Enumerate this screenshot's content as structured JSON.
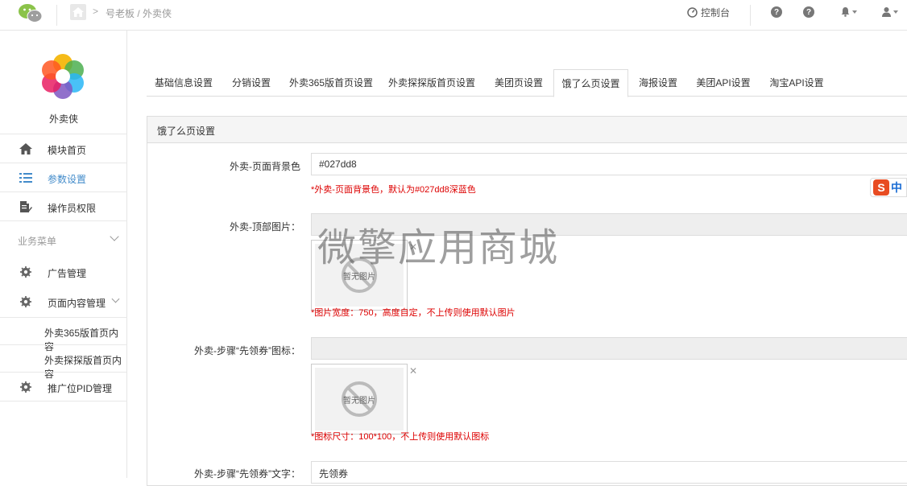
{
  "header": {
    "breadcrumb": "号老板 / 外卖侠",
    "breadcrumb_sep": ">",
    "console_label": "控制台"
  },
  "sidebar": {
    "brand_name": "外卖侠",
    "items": [
      {
        "label": "模块首页",
        "icon": "home-icon"
      },
      {
        "label": "参数设置",
        "icon": "list-icon",
        "active": true
      },
      {
        "label": "操作员权限",
        "icon": "edit-doc-icon"
      }
    ],
    "group_title": "业务菜单",
    "group_items": [
      {
        "label": "广告管理",
        "icon": "gear-icon"
      },
      {
        "label": "页面内容管理",
        "icon": "gear-icon"
      }
    ],
    "sub_items": [
      {
        "label": "外卖365版首页内容"
      },
      {
        "label": "外卖探探版首页内容"
      }
    ],
    "last_item": {
      "label": "推广位PID管理",
      "icon": "gear-icon"
    }
  },
  "tabs": [
    {
      "label": "基础信息设置"
    },
    {
      "label": "分销设置"
    },
    {
      "label": "外卖365版首页设置"
    },
    {
      "label": "外卖探探版首页设置"
    },
    {
      "label": "美团页设置"
    },
    {
      "label": "饿了么页设置",
      "active": true
    },
    {
      "label": "海报设置"
    },
    {
      "label": "美团API设置"
    },
    {
      "label": "淘宝API设置"
    }
  ],
  "panel": {
    "title": "饿了么页设置",
    "fields": [
      {
        "label": "外卖-页面背景色",
        "value": "#027dd8",
        "help": "*外卖-页面背景色，默认为#027dd8深蓝色"
      },
      {
        "label": "外卖-顶部图片：",
        "value": "",
        "image_placeholder": "暂无图片",
        "help": "*图片宽度：750，高度自定，不上传则使用默认图片"
      },
      {
        "label": "外卖-步骤“先领券”图标：",
        "value": "",
        "image_placeholder": "暂无图片",
        "help": "*图标尺寸：100*100，不上传则使用默认图标"
      },
      {
        "label": "外卖-步骤“先领券”文字：",
        "value": "先领券"
      }
    ]
  },
  "watermark": "微擎应用商城",
  "ime_indicator": {
    "logo": "S",
    "text": "中"
  },
  "colors": {
    "accent": "#428bca",
    "help_red": "#dd0000",
    "brand_orange": "#e84c22"
  }
}
